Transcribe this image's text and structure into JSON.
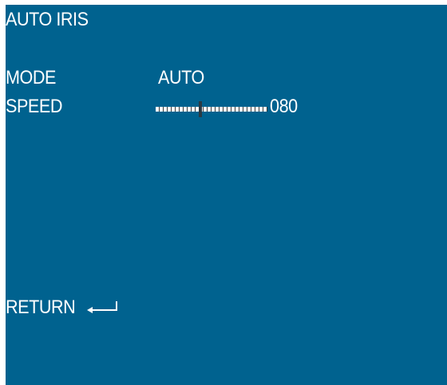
{
  "menu": {
    "title": "AUTO IRIS",
    "items": [
      {
        "label": "MODE",
        "value": "AUTO"
      },
      {
        "label": "SPEED",
        "value": "080",
        "level": 0.4
      }
    ],
    "return_label": "RETURN"
  },
  "icons": {
    "return": "enter-arrow-icon"
  },
  "colors": {
    "background": "#00628f",
    "text": "#ffffff",
    "slider_knob": "#2a3a44"
  }
}
